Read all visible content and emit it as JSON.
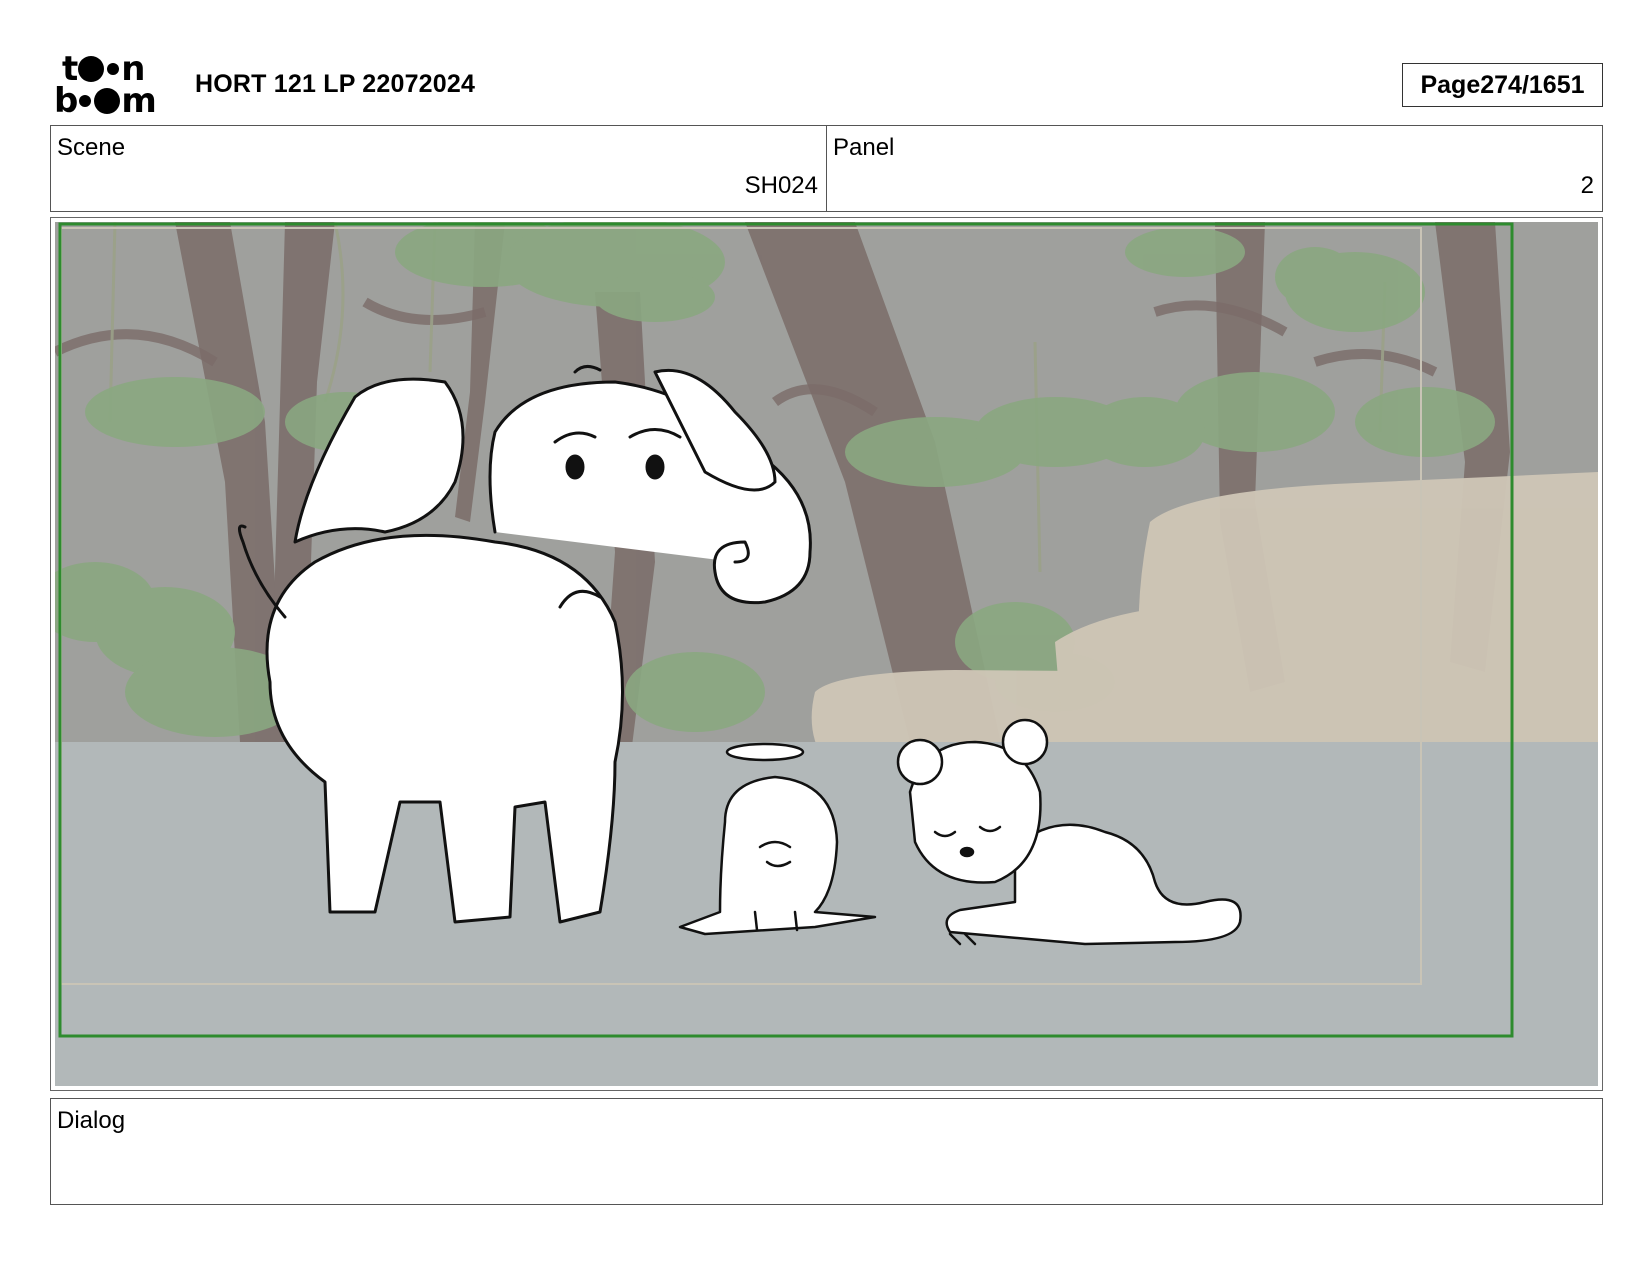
{
  "header": {
    "logo_text": "toonboom",
    "title": "HORT 121 LP 22072024",
    "page_label": "Page",
    "page_number": "274/1651"
  },
  "info": {
    "scene_label": "Scene",
    "scene_value": "SH024",
    "panel_label": "Panel",
    "panel_value": "2"
  },
  "dialog": {
    "label": "Dialog",
    "text": ""
  },
  "colors": {
    "frame_border": "#2e8b2e",
    "ground": "#b3b9ba",
    "background_tint": "#9a9c9a",
    "foliage": "#8fae86",
    "trunk": "#6e5e5c",
    "rock": "#d8cfc0"
  }
}
